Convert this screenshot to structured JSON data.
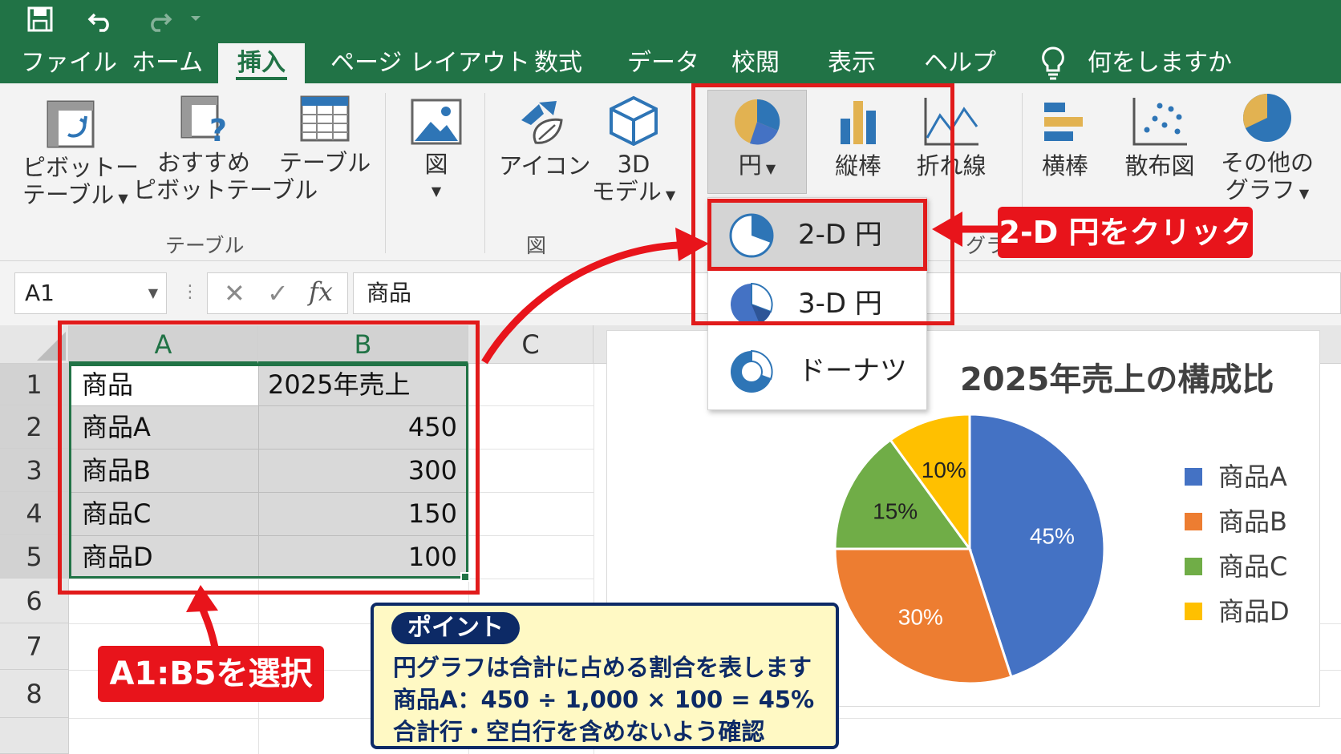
{
  "ribbon_tabs": {
    "file": "ファイル",
    "home": "ホーム",
    "insert": "挿入",
    "page_layout": "ページ レイアウト",
    "formulas": "数式",
    "data": "データ",
    "review": "校閲",
    "view": "表示",
    "help": "ヘルプ",
    "tell_me": "何をしますか"
  },
  "ribbon": {
    "pivot_table": [
      "ピボットー",
      "テーブル"
    ],
    "recommended_pivot": [
      "おすすめ",
      "ピボットテーブル"
    ],
    "table": "テーブル",
    "group_table": "テーブル",
    "picture": "図",
    "icons": "アイコン",
    "models_3d": [
      "3D",
      "モデル"
    ],
    "group_illustrations": "図",
    "pie": "円",
    "column": "縦棒",
    "line": "折れ線",
    "bar": "横棒",
    "scatter": "散布図",
    "other_charts": [
      "その他の",
      "グラフ"
    ],
    "group_charts_partial": "グラ"
  },
  "formula_bar": {
    "name_box": "A1",
    "fx": "fx",
    "content": "商品"
  },
  "sheet": {
    "columns": [
      "A",
      "B",
      "C"
    ],
    "rows": [
      "1",
      "2",
      "3",
      "4",
      "5",
      "6",
      "7",
      "8"
    ],
    "header": [
      "商品",
      "2025年売上"
    ],
    "data": [
      [
        "商品A",
        "450"
      ],
      [
        "商品B",
        "300"
      ],
      [
        "商品C",
        "150"
      ],
      [
        "商品D",
        "100"
      ]
    ]
  },
  "pie_dropdown": {
    "items": [
      "2-D 円",
      "3-D 円",
      "ドーナツ"
    ]
  },
  "annotations": {
    "click_2d": "2-D 円をクリック",
    "select_range": "A1:B5を選択",
    "point_title": "ポイント",
    "point_lines": [
      "円グラフは合計に占める割合を表します",
      "商品A：450 ÷ 1,000 × 100 = 45%",
      "合計行・空白行を含めないよう確認"
    ],
    "red_color": "#e8141b",
    "point_border_color": "#0d2a66",
    "point_bg_color": "#fff9c4"
  },
  "chart_data": {
    "type": "pie",
    "title": "2025年売上の構成比",
    "categories": [
      "商品A",
      "商品B",
      "商品C",
      "商品D"
    ],
    "values": [
      450,
      300,
      150,
      100
    ],
    "data_labels": [
      "45%",
      "30%",
      "15%",
      "10%"
    ],
    "colors": [
      "#4472c4",
      "#ed7d31",
      "#70ad47",
      "#ffc000"
    ],
    "legend_position": "right"
  },
  "colors": {
    "excel_green": "#217346",
    "ribbon_bg": "#f3f3f3",
    "selection_fill": "#d9d9d9",
    "selection_border": "#217346"
  }
}
